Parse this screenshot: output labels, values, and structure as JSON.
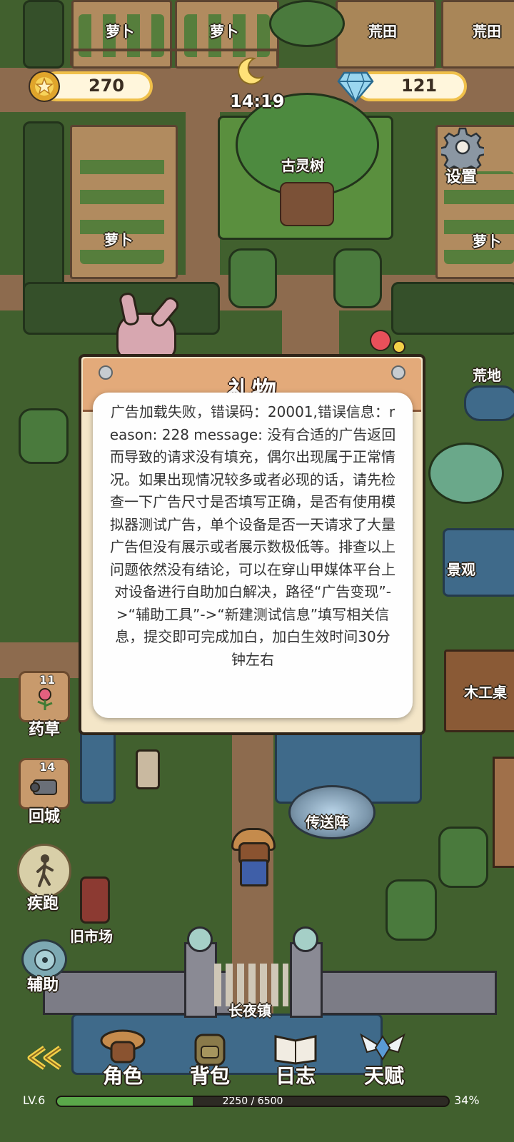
{
  "hud": {
    "coins": "270",
    "gems": "121",
    "time": "14:19"
  },
  "map_labels": {
    "carrot_1": "萝卜",
    "carrot_2": "萝卜",
    "wasteland_1": "荒田",
    "wasteland_2": "荒田",
    "ancient_tree": "古灵树",
    "carrot_3": "萝卜",
    "carrot_4": "萝卜",
    "barren": "荒地",
    "scenery": "景观",
    "woodworker": "木工桌",
    "teleport": "传送阵",
    "old_market": "旧市场",
    "town": "长夜镇"
  },
  "side_buttons": {
    "settings": "设置",
    "herbs": {
      "label": "药草",
      "count": "11"
    },
    "return_city": {
      "label": "回城",
      "count": "14"
    },
    "sprint": "疾跑",
    "assist": "辅助"
  },
  "dialog": {
    "title": "礼物"
  },
  "toast": {
    "message": "广告加载失败，错误码：20001,错误信息：reason: 228  message: 没有合适的广告返回而导致的请求没有填充，偶尔出现属于正常情况。如果出现情况较多或者必现的话，请先检查一下广告尺寸是否填写正确，是否有使用模拟器测试广告，单个设备是否一天请求了大量广告但没有展示或者展示数极低等。排查以上问题依然没有结论，可以在穿山甲媒体平台上对设备进行自助加白解决，路径“广告变现”->“辅助工具”->“新建测试信息”填写相关信息，提交即可完成加白，加白生效时间30分钟左右"
  },
  "bottom_nav": {
    "character": "角色",
    "backpack": "背包",
    "journal": "日志",
    "talent": "天赋"
  },
  "status": {
    "level": "LV.6",
    "xp_text": "2250 / 6500",
    "xp_percent": "34%",
    "xp_fraction": 0.346
  },
  "colors": {
    "coin_pill_border": "#f0c04a",
    "xp_fill": "#5aa84a",
    "dialog_bg": "#f4e6c8",
    "dialog_header": "#e3aa7a"
  }
}
